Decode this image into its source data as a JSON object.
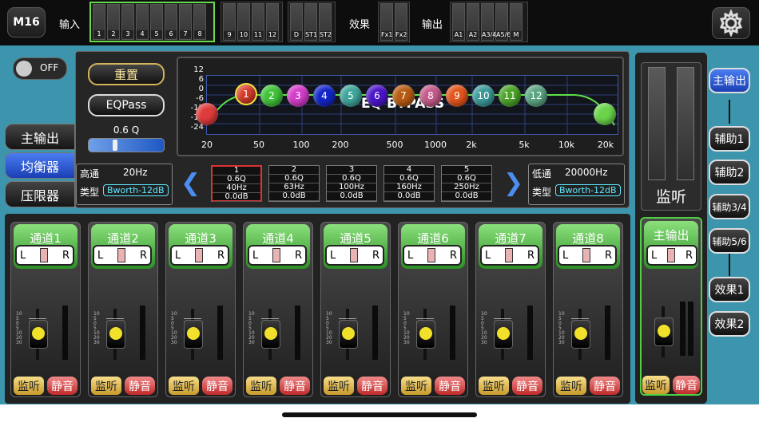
{
  "app": {
    "model": "M16",
    "enable": "OFF"
  },
  "topbar": {
    "labels": {
      "input": "输入",
      "effects": "效果",
      "output": "输出"
    },
    "input_meters": [
      "1",
      "2",
      "3",
      "4",
      "5",
      "6",
      "7",
      "8"
    ],
    "input_meters2": [
      "9",
      "10",
      "11",
      "12"
    ],
    "input_meters3": [
      "D",
      "ST1",
      "ST2"
    ],
    "fx_meters": [
      "Fx1",
      "Fx2"
    ],
    "out_meters": [
      "A1",
      "A2",
      "A3/4",
      "A5/6",
      "M"
    ]
  },
  "left_tabs": [
    "主输出",
    "均衡器",
    "压限器"
  ],
  "eq": {
    "reset": "重置",
    "eqpass": "EQPass",
    "q_label": "0.6 Q",
    "bypass_text": "EQ BYPASS",
    "y_ticks": [
      "12",
      "6",
      "0",
      "-6",
      "-12",
      "-18",
      "-24"
    ],
    "x_ticks": [
      "20",
      "50",
      "100",
      "200",
      "500",
      "1000",
      "2k",
      "5k",
      "10k",
      "20k"
    ],
    "bands": [
      "1",
      "2",
      "3",
      "4",
      "5",
      "6",
      "7",
      "8",
      "9",
      "10",
      "11",
      "12"
    ],
    "band_colors": [
      "#d93a2a",
      "#40c23a",
      "#d43cc9",
      "#1226c9",
      "#3fa59a",
      "#4b15c9",
      "#b85b12",
      "#c45a8a",
      "#e3551c",
      "#3c9a9a",
      "#4ba327",
      "#5aa582"
    ],
    "highpass": {
      "label": "高通",
      "freq": "20Hz",
      "type_label": "类型",
      "type": "Bworth-12dB"
    },
    "lowpass": {
      "label": "低通",
      "freq": "20000Hz",
      "type_label": "类型",
      "type": "Bworth-12dB"
    },
    "band_details": [
      {
        "n": "1",
        "q": "0.6Q",
        "f": "40Hz",
        "g": "0.0dB"
      },
      {
        "n": "2",
        "q": "0.6Q",
        "f": "63Hz",
        "g": "0.0dB"
      },
      {
        "n": "3",
        "q": "0.6Q",
        "f": "100Hz",
        "g": "0.0dB"
      },
      {
        "n": "4",
        "q": "0.6Q",
        "f": "160Hz",
        "g": "0.0dB"
      },
      {
        "n": "5",
        "q": "0.6Q",
        "f": "250Hz",
        "g": "0.0dB"
      }
    ]
  },
  "channels": [
    "通道1",
    "通道2",
    "通道3",
    "通道4",
    "通道5",
    "通道6",
    "通道7",
    "通道8"
  ],
  "channel_strip": {
    "l": "L",
    "r": "R",
    "monitor": "监听",
    "mute": "静音"
  },
  "monitor": {
    "label": "监听"
  },
  "main_out": {
    "name": "主输出",
    "l": "L",
    "r": "R",
    "monitor": "监听",
    "mute": "静音"
  },
  "routes": [
    "主输出",
    "辅助1",
    "辅助2",
    "辅助3/4",
    "辅助5/6",
    "效果1",
    "效果2"
  ]
}
